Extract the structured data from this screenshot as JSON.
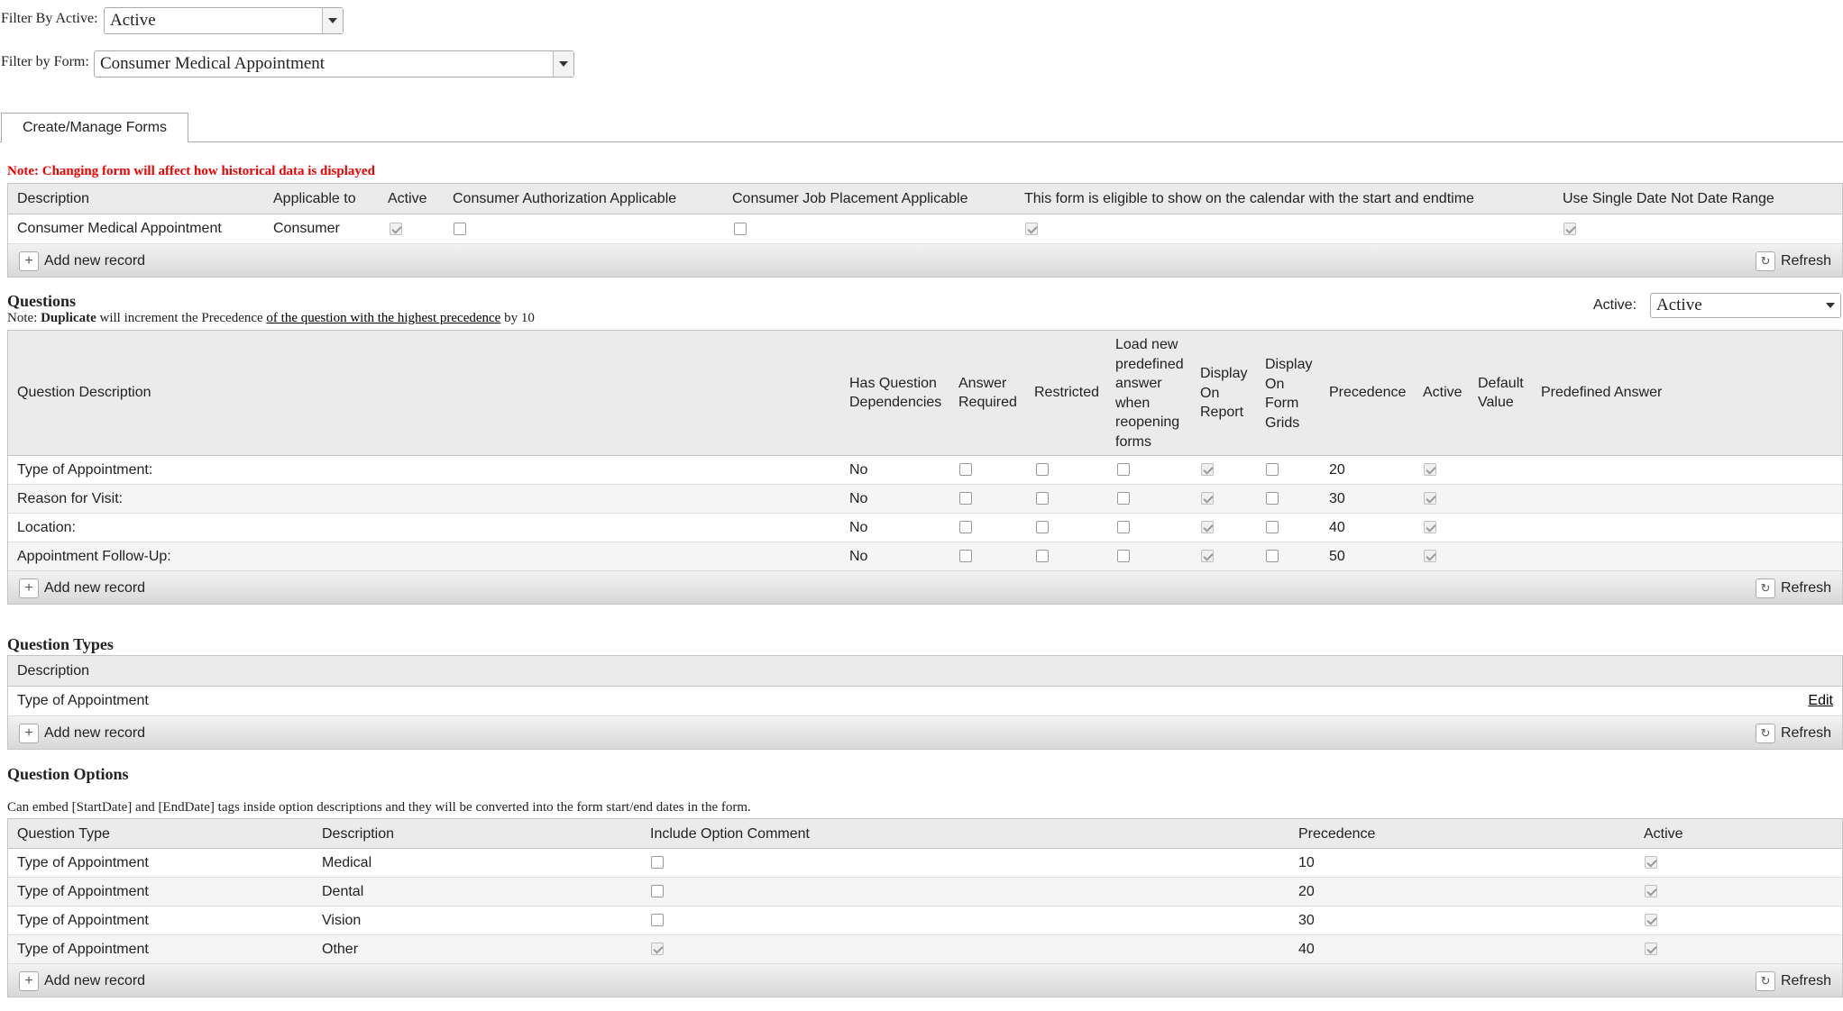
{
  "filters": {
    "active_label": "Filter By Active:",
    "active_value": "Active",
    "form_label": "Filter by Form:",
    "form_value": "Consumer Medical Appointment"
  },
  "tab": {
    "label": "Create/Manage Forms"
  },
  "warning": "Note: Changing form will affect how historical data is displayed",
  "forms_grid": {
    "headers": [
      "Description",
      "Applicable to",
      "Active",
      "Consumer Authorization Applicable",
      "Consumer Job Placement Applicable",
      "This form is eligible to show on the calendar with the start and endtime",
      "Use Single Date Not Date Range"
    ],
    "row": {
      "description": "Consumer Medical Appointment",
      "applicable_to": "Consumer",
      "active": true,
      "auth_applicable": false,
      "job_placement": false,
      "calendar": true,
      "single_date": true
    },
    "add_label": "Add new record",
    "refresh_label": "Refresh"
  },
  "questions": {
    "title": "Questions",
    "note_prefix": "Note:",
    "note_bold": "Duplicate",
    "note_mid": "will increment the Precedence",
    "note_link": "of the question with the highest precedence",
    "note_suffix": "by 10",
    "active_label": "Active:",
    "active_value": "Active",
    "headers": {
      "description": "Question Description",
      "has_deps": "Has Question Dependencies",
      "answer_required": "Answer Required",
      "restricted": "Restricted",
      "load_new": "Load new predefined answer when reopening forms",
      "display_report": "Display On Report",
      "display_grids": "Display On Form Grids",
      "precedence": "Precedence",
      "active": "Active",
      "default_value": "Default Value",
      "predefined_answer": "Predefined Answer"
    },
    "rows": [
      {
        "description": "Type of Appointment:",
        "has_deps": "No",
        "precedence": "20"
      },
      {
        "description": "Reason for Visit:",
        "has_deps": "No",
        "precedence": "30"
      },
      {
        "description": "Location:",
        "has_deps": "No",
        "precedence": "40"
      },
      {
        "description": "Appointment Follow-Up:",
        "has_deps": "No",
        "precedence": "50"
      }
    ],
    "add_label": "Add new record",
    "refresh_label": "Refresh"
  },
  "question_types": {
    "title": "Question Types",
    "header": "Description",
    "rows": [
      {
        "description": "Type of Appointment",
        "edit": "Edit"
      }
    ],
    "add_label": "Add new record",
    "refresh_label": "Refresh"
  },
  "question_options": {
    "title": "Question Options",
    "note": "Can embed [StartDate] and [EndDate] tags inside option descriptions and they will be converted into the form start/end dates in the form.",
    "headers": [
      "Question Type",
      "Description",
      "Include Option Comment",
      "Precedence",
      "Active"
    ],
    "rows": [
      {
        "type": "Type of Appointment",
        "description": "Medical",
        "comment": false,
        "precedence": "10"
      },
      {
        "type": "Type of Appointment",
        "description": "Dental",
        "comment": false,
        "precedence": "20"
      },
      {
        "type": "Type of Appointment",
        "description": "Vision",
        "comment": false,
        "precedence": "30"
      },
      {
        "type": "Type of Appointment",
        "description": "Other",
        "comment": true,
        "precedence": "40"
      }
    ],
    "add_label": "Add new record",
    "refresh_label": "Refresh"
  }
}
